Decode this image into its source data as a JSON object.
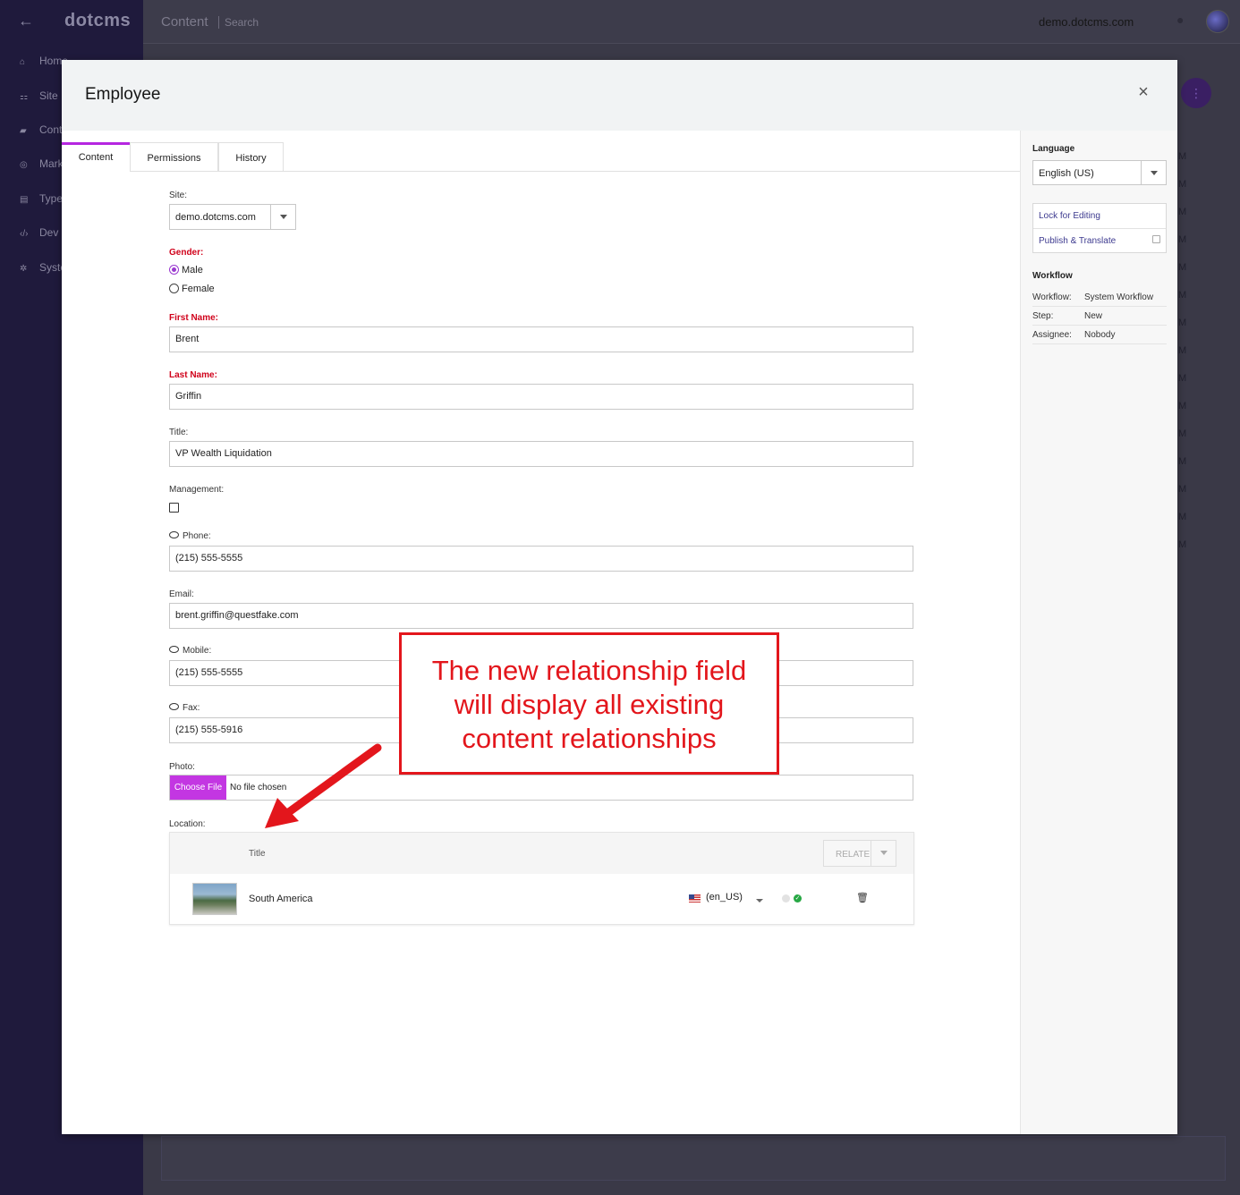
{
  "background": {
    "logo": "dotcms",
    "nav": [
      "Home",
      "Site",
      "Cont",
      "Mark",
      "Type",
      "Dev",
      "Syste"
    ],
    "header": {
      "section": "Content",
      "subsection": "Search",
      "site": "demo.dotcms.com"
    },
    "fab": "⋮",
    "col_letter": "M"
  },
  "dialog": {
    "title": "Employee",
    "close_icon": "×",
    "tabs": [
      {
        "label": "Content",
        "active": true
      },
      {
        "label": "Permissions",
        "active": false
      },
      {
        "label": "History",
        "active": false
      }
    ]
  },
  "form": {
    "site": {
      "label": "Site:",
      "value": "demo.dotcms.com"
    },
    "gender": {
      "label": "Gender:",
      "options": [
        "Male",
        "Female"
      ],
      "selected": "Male"
    },
    "first_name": {
      "label": "First Name:",
      "value": "Brent"
    },
    "last_name": {
      "label": "Last Name:",
      "value": "Griffin"
    },
    "title": {
      "label": "Title:",
      "value": "VP Wealth Liquidation"
    },
    "management": {
      "label": "Management:",
      "checked": false
    },
    "phone": {
      "label": "Phone:",
      "value": "(215) 555-5555"
    },
    "email": {
      "label": "Email:",
      "value": "brent.griffin@questfake.com"
    },
    "mobile": {
      "label": "Mobile:",
      "value": "(215) 555-5555"
    },
    "fax": {
      "label": "Fax:",
      "value": "(215) 555-5916"
    },
    "photo": {
      "label": "Photo:",
      "button": "Choose File",
      "status": "No file chosen"
    },
    "location": {
      "label": "Location:",
      "column_title": "Title",
      "relate_button": "RELATE",
      "rows": [
        {
          "title": "South America",
          "language": "(en_US)"
        }
      ]
    }
  },
  "sidebar": {
    "language_heading": "Language",
    "language_value": "English (US)",
    "actions": [
      "Lock for Editing",
      "Publish & Translate"
    ],
    "workflow_heading": "Workflow",
    "workflow": [
      {
        "key": "Workflow:",
        "value": "System Workflow"
      },
      {
        "key": "Step:",
        "value": "New"
      },
      {
        "key": "Assignee:",
        "value": "Nobody"
      }
    ]
  },
  "annotation": {
    "lines": [
      "The new relationship field",
      "will display all existing",
      "content relationships"
    ],
    "color": "#e3161c"
  },
  "colors": {
    "accent": "#c336e2",
    "required": "#d0021b",
    "link": "#3d3a8f",
    "status_ok": "#27a844"
  }
}
